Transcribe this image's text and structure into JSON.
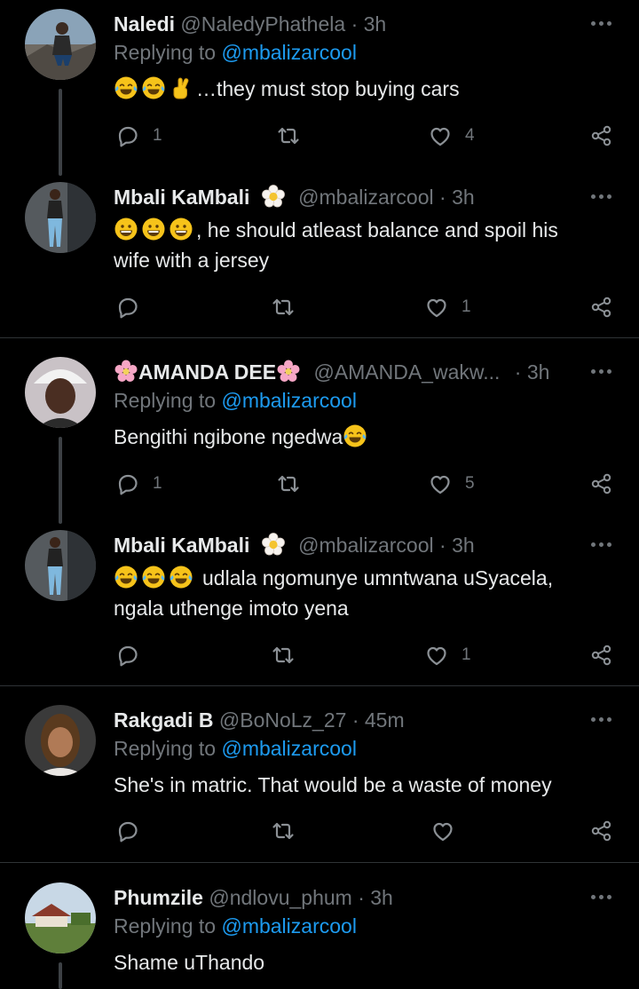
{
  "replying_prefix": "Replying to",
  "tweets": [
    {
      "name": "Naledi",
      "handle": "@NaledyPhathela",
      "time": "3h",
      "replying_to": "@mbalizarcool",
      "text": "…they must stop buying cars",
      "emojis": [
        "face-with-tears-of-joy",
        "face-with-tears-of-joy",
        "crossed-fingers"
      ],
      "replies": "1",
      "retweets": "",
      "likes": "4"
    },
    {
      "name": "Mbali KaMbali",
      "badge": "flower-emoji",
      "handle": "@mbalizarcool",
      "time": "3h",
      "text_line1": ", he should atleast balance and spoil his",
      "text_line2": "wife with a jersey",
      "emojis": [
        "grinning-face",
        "grinning-face",
        "grinning-face"
      ],
      "replies": "",
      "retweets": "",
      "likes": "1"
    },
    {
      "name": "AMANDA DEE",
      "name_emojis": [
        "cherry-blossom",
        "cherry-blossom"
      ],
      "handle": "@AMANDA_wakw...",
      "time": "3h",
      "replying_to": "@mbalizarcool",
      "text": "Bengithi ngibone ngedwa",
      "emojis": [
        "face-with-tears-of-joy"
      ],
      "replies": "1",
      "retweets": "",
      "likes": "5"
    },
    {
      "name": "Mbali KaMbali",
      "badge": "flower-emoji",
      "handle": "@mbalizarcool",
      "time": "3h",
      "text_line1": "udlala ngomunye umntwana uSyacela,",
      "text_line2": "ngala uthenge imoto yena",
      "emojis": [
        "face-with-tears-of-joy",
        "face-with-tears-of-joy",
        "face-with-tears-of-joy"
      ],
      "replies": "",
      "retweets": "",
      "likes": "1"
    },
    {
      "name": "Rakgadi B",
      "handle": "@BoNoLz_27",
      "time": "45m",
      "replying_to": "@mbalizarcool",
      "text": "She's in matric. That would be a waste of money",
      "replies": "",
      "retweets": "",
      "likes": ""
    },
    {
      "name": "Phumzile",
      "handle": "@ndlovu_phum",
      "time": "3h",
      "replying_to": "@mbalizarcool",
      "text": "Shame uThando"
    }
  ],
  "colors": {
    "background": "#000000",
    "text": "#e7e9ea",
    "muted": "#71767b",
    "link": "#1d9bf0",
    "divider": "#2f3336"
  }
}
